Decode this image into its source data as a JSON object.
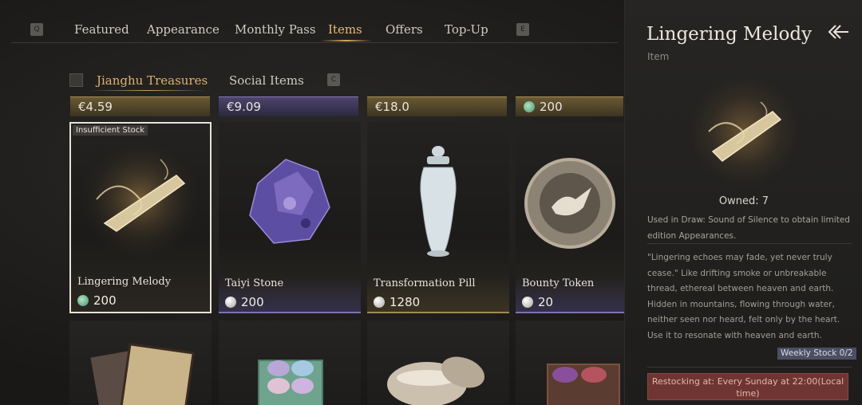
{
  "topnav": {
    "tabs": [
      "Featured",
      "Appearance",
      "Monthly Pass",
      "Items",
      "Offers",
      "Top-Up"
    ],
    "active": "Items",
    "left_key": "Q",
    "right_key": "E"
  },
  "subnav": {
    "tabs": [
      "Jianghu Treasures",
      "Social Items"
    ],
    "right_key": "C"
  },
  "price_bars": [
    "€4.59",
    "€9.09",
    "€18.0",
    "200"
  ],
  "items": [
    {
      "name": "Lingering Melody",
      "price": "200",
      "currency": "jade",
      "stock_label": "Insufficient Stock"
    },
    {
      "name": "Taiyi Stone",
      "price": "200",
      "currency": "pearl"
    },
    {
      "name": "Transformation Pill",
      "price": "1280",
      "currency": "pearl"
    },
    {
      "name": "Bounty Token",
      "price": "20",
      "currency": "pearl"
    }
  ],
  "detail": {
    "title": "Lingering Melody",
    "subtitle": "Item",
    "owned": "Owned: 7",
    "description": "Used in Draw: Sound of Silence to obtain limited edition Appearances.",
    "lore": "\"Lingering echoes may fade, yet never truly cease.\" Like drifting smoke or unbreakable thread, ethereal between heaven and earth. Hidden in mountains, flowing through water, neither seen nor heard, felt only by the heart.",
    "lore_use": "Use it to resonate with heaven and earth.",
    "weekly_stock": "Weekly Stock 0/2",
    "restock": "Restocking at: Every Sunday at 22:00(Local time)"
  },
  "colors": {
    "accent": "#e4b978",
    "restock_bg": "#6f3532",
    "weekly_bg": "#4a4f64"
  }
}
